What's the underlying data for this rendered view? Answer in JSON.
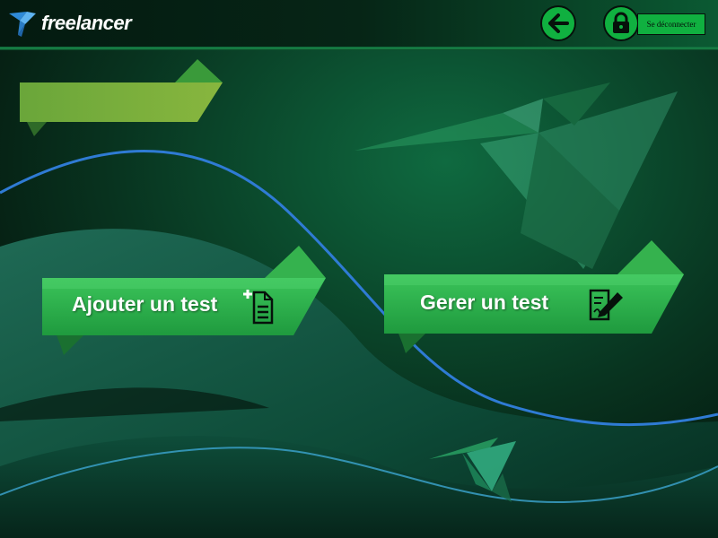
{
  "app": {
    "logo_text": "freelancer"
  },
  "header": {
    "back_icon": "arrow-left-icon",
    "lock_icon": "lock-icon",
    "logout_label": "Se déconnecter"
  },
  "actions": {
    "add_test": {
      "label": "Ajouter un test",
      "icon": "add-document-icon"
    },
    "manage_test": {
      "label": "Gerer un test",
      "icon": "edit-document-icon"
    }
  },
  "title_banner": {
    "label": ""
  },
  "colors": {
    "button_green": "#10b040",
    "ribbon_green": "#2fb84e",
    "banner_olive": "#6fa83a",
    "wave_blue": "#2f7bd4",
    "background_dark": "#05120c"
  }
}
